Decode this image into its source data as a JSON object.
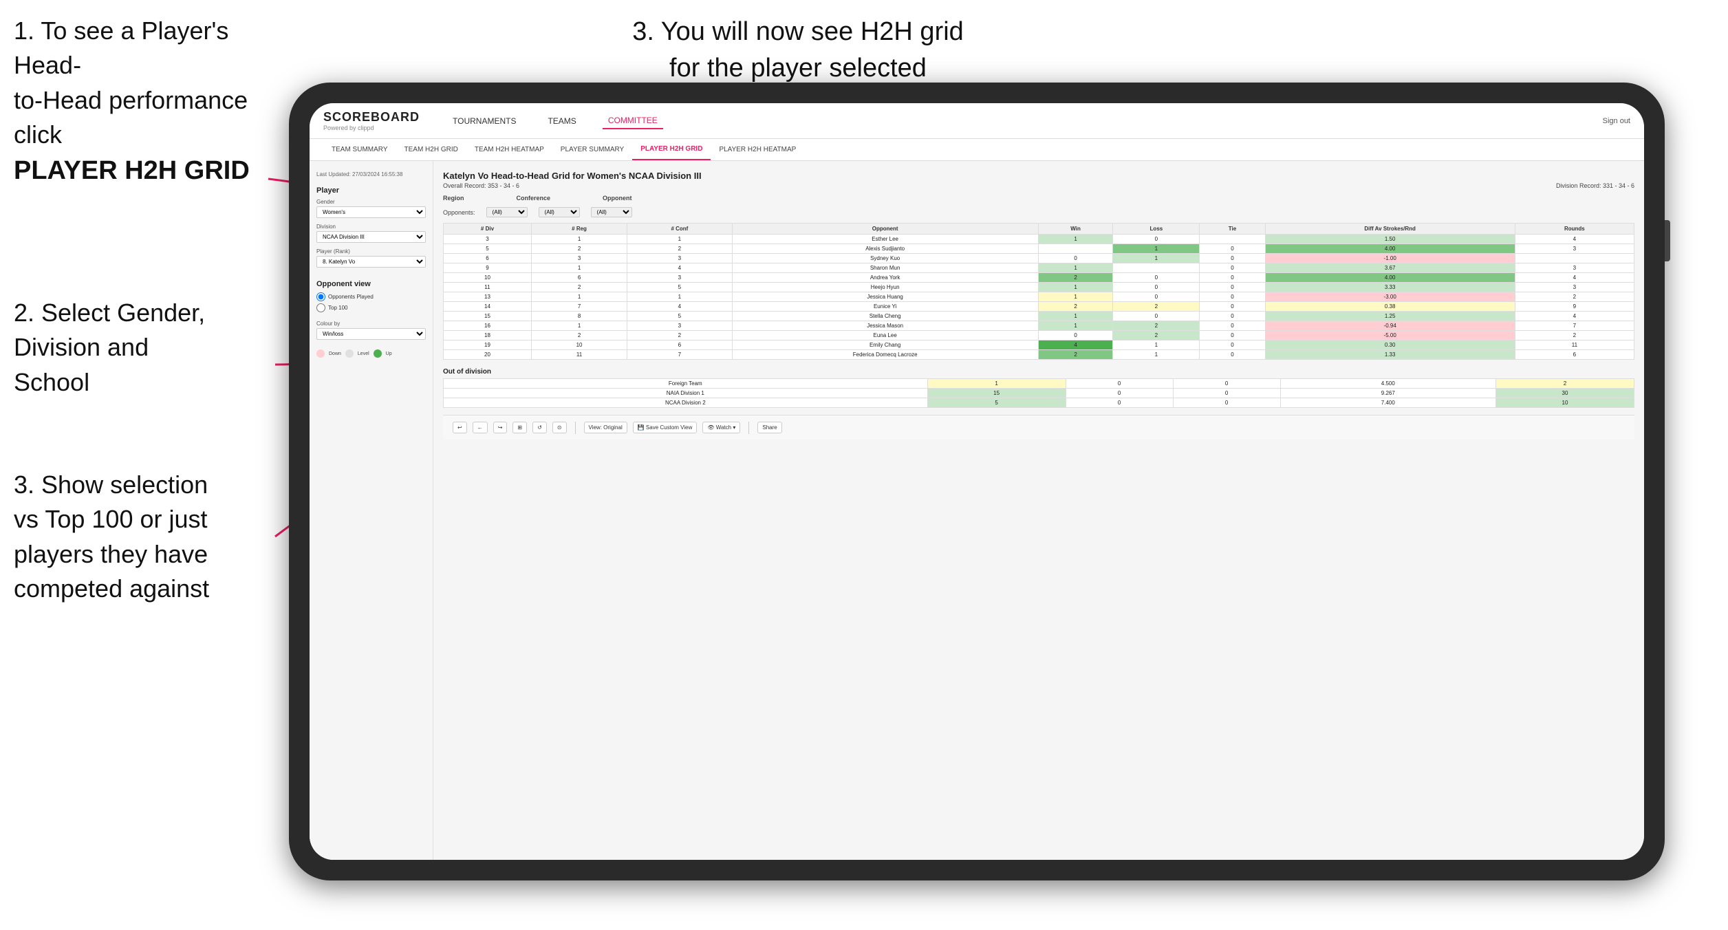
{
  "instructions": {
    "step1_line1": "1. To see a Player's Head-",
    "step1_line2": "to-Head performance click",
    "step1_bold": "PLAYER H2H GRID",
    "step2_title": "2. Select Gender,",
    "step2_line2": "Division and",
    "step2_line3": "School",
    "step3_top_line1": "3. You will now see H2H grid",
    "step3_top_line2": "for the player selected",
    "step3_bottom_title": "3. Show selection",
    "step3_bottom_line2": "vs Top 100 or just",
    "step3_bottom_line3": "players they have",
    "step3_bottom_line4": "competed against"
  },
  "header": {
    "logo": "SCOREBOARD",
    "logo_sub": "Powered by clippd",
    "nav_items": [
      "TOURNAMENTS",
      "TEAMS",
      "COMMITTEE"
    ],
    "active_nav": "COMMITTEE",
    "sign_out": "Sign out"
  },
  "sub_nav": {
    "items": [
      "TEAM SUMMARY",
      "TEAM H2H GRID",
      "TEAM H2H HEATMAP",
      "PLAYER SUMMARY",
      "PLAYER H2H GRID",
      "PLAYER H2H HEATMAP"
    ],
    "active": "PLAYER H2H GRID"
  },
  "sidebar": {
    "timestamp": "Last Updated: 27/03/2024\n16:55:38",
    "player_section": "Player",
    "gender_label": "Gender",
    "gender_value": "Women's",
    "division_label": "Division",
    "division_value": "NCAA Division III",
    "player_rank_label": "Player (Rank)",
    "player_rank_value": "8. Katelyn Vo",
    "opponent_view_title": "Opponent view",
    "radio1": "Opponents Played",
    "radio2": "Top 100",
    "colour_by": "Colour by",
    "colour_value": "Win/loss",
    "legend": {
      "down_label": "Down",
      "level_label": "Level",
      "up_label": "Up"
    }
  },
  "grid": {
    "title": "Katelyn Vo Head-to-Head Grid for Women's NCAA Division III",
    "overall_record": "Overall Record: 353 - 34 - 6",
    "division_record": "Division Record: 331 - 34 - 6",
    "region_label": "Region",
    "conference_label": "Conference",
    "opponent_label": "Opponent",
    "opponents_label": "Opponents:",
    "filter_all": "(All)",
    "columns": [
      "# Div",
      "# Reg",
      "# Conf",
      "Opponent",
      "Win",
      "Loss",
      "Tie",
      "Diff Av Strokes/Rnd",
      "Rounds"
    ],
    "rows": [
      {
        "div": "3",
        "reg": "1",
        "conf": "1",
        "opponent": "Esther Lee",
        "win": "1",
        "loss": "0",
        "tie": "",
        "diff": "1.50",
        "rounds": "4",
        "win_color": "green_light",
        "loss_color": "",
        "diff_color": "green_light"
      },
      {
        "div": "5",
        "reg": "2",
        "conf": "2",
        "opponent": "Alexis Sudjianto",
        "win": "",
        "loss": "1",
        "tie": "0",
        "diff": "4.00",
        "rounds": "3",
        "win_color": "",
        "loss_color": "green_mid",
        "diff_color": "green_mid"
      },
      {
        "div": "6",
        "reg": "3",
        "conf": "3",
        "opponent": "Sydney Kuo",
        "win": "0",
        "loss": "1",
        "tie": "0",
        "diff": "-1.00",
        "rounds": "",
        "win_color": "",
        "loss_color": "green_light",
        "diff_color": "red_light"
      },
      {
        "div": "9",
        "reg": "1",
        "conf": "4",
        "opponent": "Sharon Mun",
        "win": "1",
        "loss": "",
        "tie": "0",
        "diff": "3.67",
        "rounds": "3",
        "win_color": "green_light",
        "loss_color": "",
        "diff_color": "green_light"
      },
      {
        "div": "10",
        "reg": "6",
        "conf": "3",
        "opponent": "Andrea York",
        "win": "2",
        "loss": "0",
        "tie": "0",
        "diff": "4.00",
        "rounds": "4",
        "win_color": "green_mid",
        "loss_color": "",
        "diff_color": "green_mid"
      },
      {
        "div": "11",
        "reg": "2",
        "conf": "5",
        "opponent": "Heejo Hyun",
        "win": "1",
        "loss": "0",
        "tie": "0",
        "diff": "3.33",
        "rounds": "3",
        "win_color": "green_light",
        "loss_color": "",
        "diff_color": "green_light"
      },
      {
        "div": "13",
        "reg": "1",
        "conf": "1",
        "opponent": "Jessica Huang",
        "win": "1",
        "loss": "0",
        "tie": "0",
        "diff": "-3.00",
        "rounds": "2",
        "win_color": "yellow",
        "loss_color": "",
        "diff_color": "red_light"
      },
      {
        "div": "14",
        "reg": "7",
        "conf": "4",
        "opponent": "Eunice Yi",
        "win": "2",
        "loss": "2",
        "tie": "0",
        "diff": "0.38",
        "rounds": "9",
        "win_color": "yellow",
        "loss_color": "yellow",
        "diff_color": "yellow"
      },
      {
        "div": "15",
        "reg": "8",
        "conf": "5",
        "opponent": "Stella Cheng",
        "win": "1",
        "loss": "0",
        "tie": "0",
        "diff": "1.25",
        "rounds": "4",
        "win_color": "green_light",
        "loss_color": "",
        "diff_color": "green_light"
      },
      {
        "div": "16",
        "reg": "1",
        "conf": "3",
        "opponent": "Jessica Mason",
        "win": "1",
        "loss": "2",
        "tie": "0",
        "diff": "-0.94",
        "rounds": "7",
        "win_color": "green_light",
        "loss_color": "green_light",
        "diff_color": "red_light"
      },
      {
        "div": "18",
        "reg": "2",
        "conf": "2",
        "opponent": "Euna Lee",
        "win": "0",
        "loss": "2",
        "tie": "0",
        "diff": "-5.00",
        "rounds": "2",
        "win_color": "",
        "loss_color": "green_light",
        "diff_color": "red_light"
      },
      {
        "div": "19",
        "reg": "10",
        "conf": "6",
        "opponent": "Emily Chang",
        "win": "4",
        "loss": "1",
        "tie": "0",
        "diff": "0.30",
        "rounds": "11",
        "win_color": "green_dark",
        "loss_color": "",
        "diff_color": "green_light"
      },
      {
        "div": "20",
        "reg": "11",
        "conf": "7",
        "opponent": "Federica Domecq Lacroze",
        "win": "2",
        "loss": "1",
        "tie": "0",
        "diff": "1.33",
        "rounds": "6",
        "win_color": "green_mid",
        "loss_color": "",
        "diff_color": "green_light"
      }
    ],
    "out_of_division_title": "Out of division",
    "out_div_rows": [
      {
        "label": "Foreign Team",
        "win": "1",
        "loss": "0",
        "tie": "0",
        "diff": "4.500",
        "rounds": "2"
      },
      {
        "label": "NAIA Division 1",
        "win": "15",
        "loss": "0",
        "tie": "0",
        "diff": "9.267",
        "rounds": "30"
      },
      {
        "label": "NCAA Division 2",
        "win": "5",
        "loss": "0",
        "tie": "0",
        "diff": "7.400",
        "rounds": "10"
      }
    ]
  },
  "toolbar": {
    "buttons": [
      "↩",
      "←",
      "↪",
      "⊞",
      "↺",
      "⊙",
      "View: Original",
      "Save Custom View",
      "Watch ▾",
      "⬛",
      "Share"
    ]
  }
}
